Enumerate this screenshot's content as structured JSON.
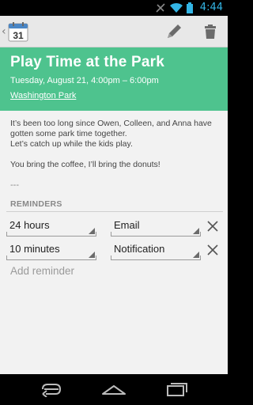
{
  "status_bar": {
    "time": "4:44"
  },
  "action_bar": {
    "app_icon_label": "31"
  },
  "event": {
    "title": "Play Time at the Park",
    "when": "Tuesday, August 21, 4:00pm – 6:00pm",
    "where": "Washington Park",
    "description": [
      "It’s been too long since Owen, Colleen, and Anna have gotten some park time together.",
      "Let’s catch up while the kids play.",
      "You bring the coffee, I’ll bring the donuts!"
    ],
    "separator": "---"
  },
  "reminders": {
    "header": "REMINDERS",
    "items": [
      {
        "time": "24 hours",
        "method": "Email"
      },
      {
        "time": "10 minutes",
        "method": "Notification"
      }
    ],
    "add_label": "Add reminder"
  },
  "colors": {
    "header_bg": "#4ec38e",
    "status_accent": "#33b5e5"
  }
}
